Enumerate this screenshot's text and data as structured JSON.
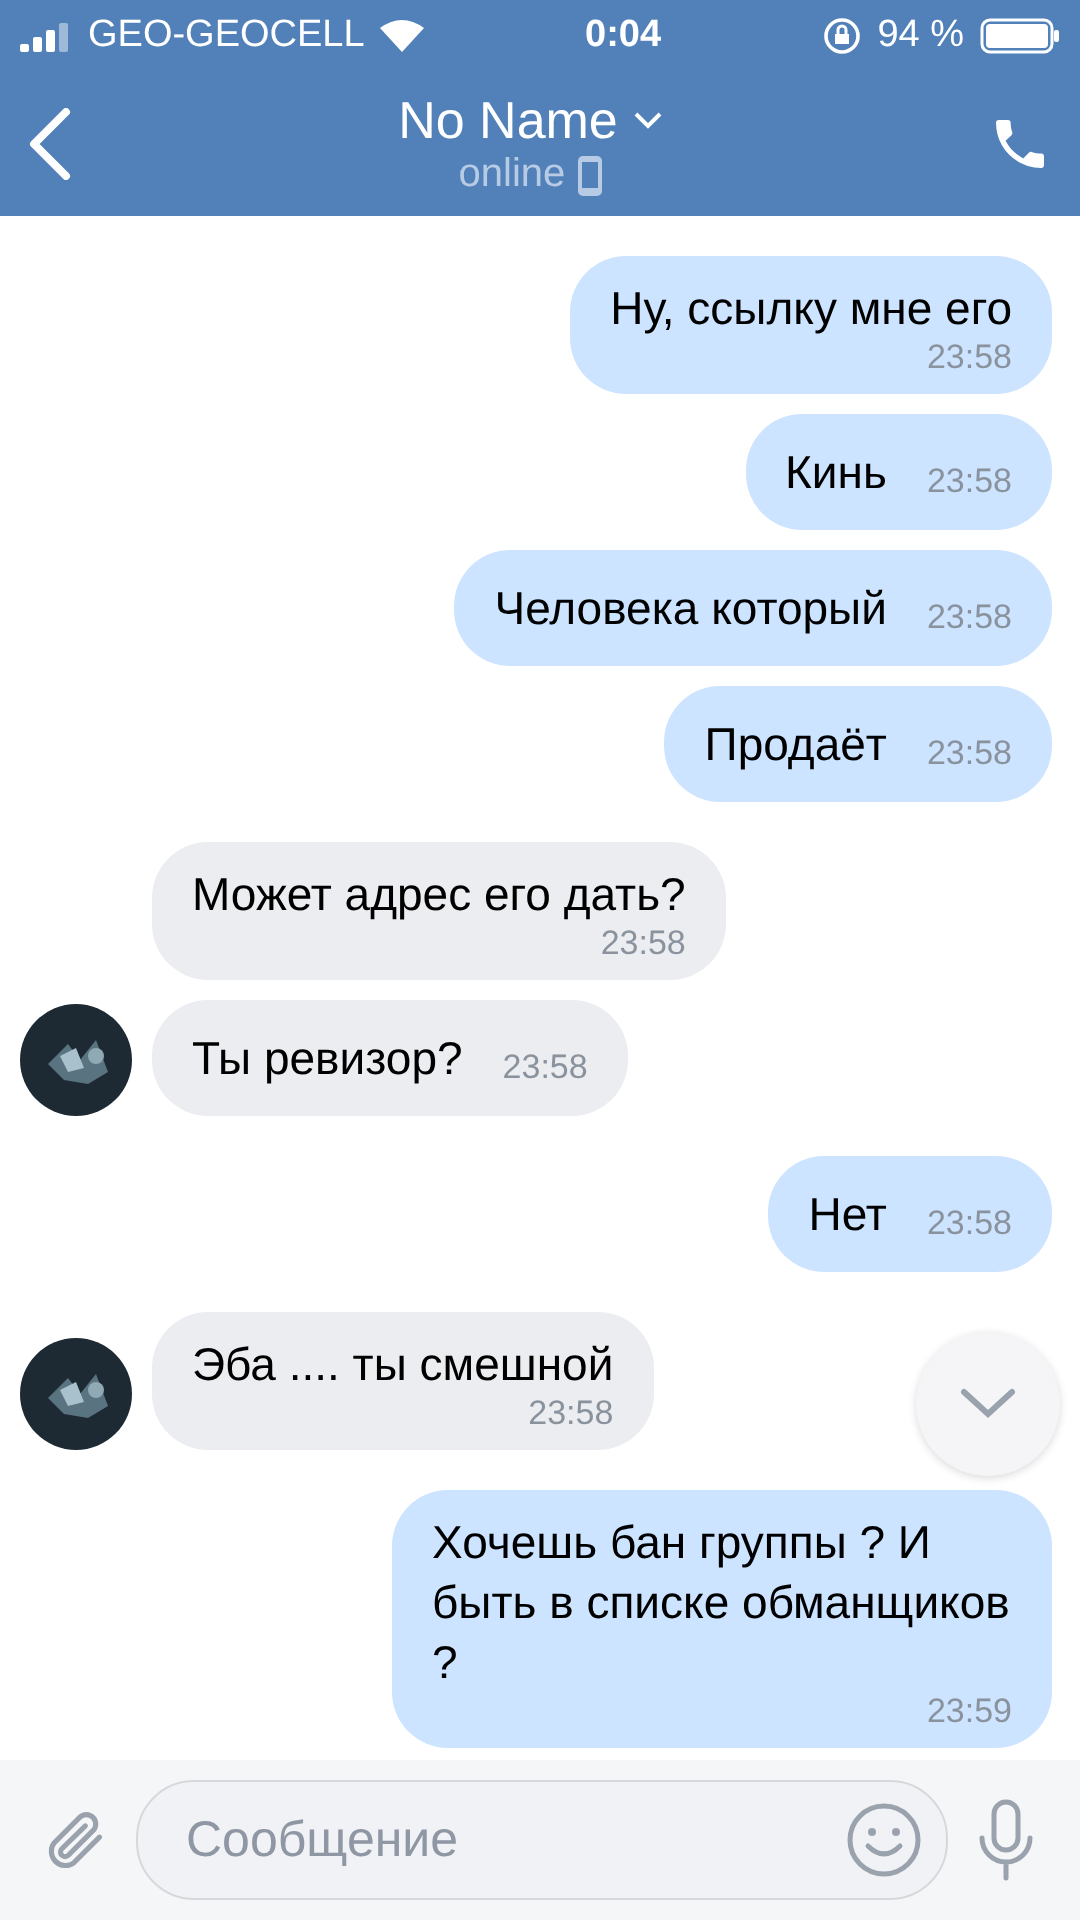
{
  "status_bar": {
    "carrier": "GEO-GEOCELL",
    "time": "0:04",
    "battery": "94 %"
  },
  "header": {
    "title": "No Name",
    "subtitle": "online"
  },
  "messages": [
    {
      "outgoing": true,
      "kind": "stacked",
      "text": "Ну, ссылку мне его",
      "time": "23:58"
    },
    {
      "outgoing": true,
      "kind": "inline",
      "text": "Кинь",
      "time": "23:58"
    },
    {
      "outgoing": true,
      "kind": "inline",
      "text": "Человека который",
      "time": "23:58"
    },
    {
      "outgoing": true,
      "kind": "inline",
      "text": "Продаёт",
      "time": "23:58"
    },
    {
      "outgoing": false,
      "kind": "stacked",
      "text": "Может адрес его дать?",
      "time": "23:58",
      "avatar": false
    },
    {
      "outgoing": false,
      "kind": "inline",
      "text": "Ты ревизор?",
      "time": "23:58",
      "avatar": true
    },
    {
      "outgoing": true,
      "kind": "inline",
      "text": "Нет",
      "time": "23:58"
    },
    {
      "outgoing": false,
      "kind": "stacked",
      "text": "Эба .... ты смешной",
      "time": "23:58",
      "avatar": true
    },
    {
      "outgoing": true,
      "kind": "stacked",
      "text": "Хочешь бан группы ? И быть в списке обманщиков ?",
      "time": "23:59"
    }
  ],
  "composer": {
    "placeholder": "Сообщение"
  }
}
